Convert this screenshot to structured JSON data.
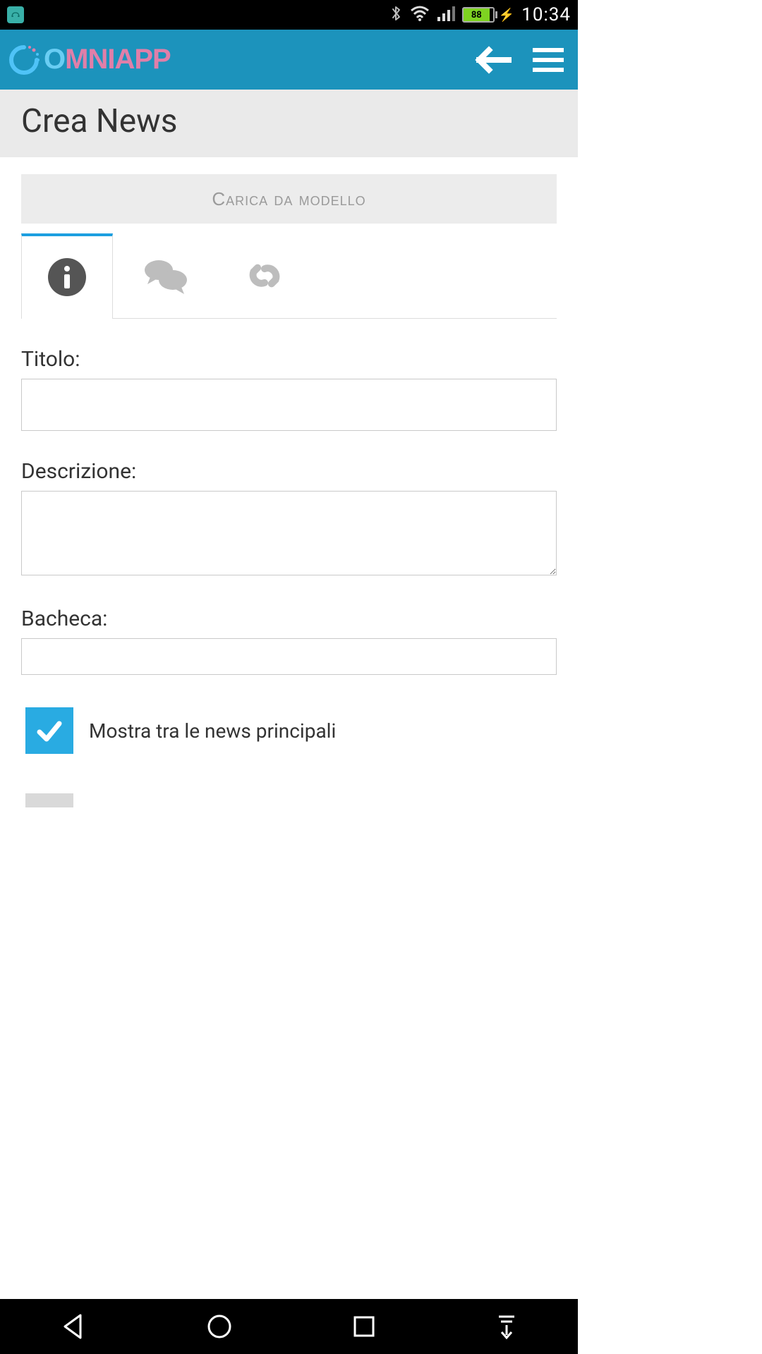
{
  "status_bar": {
    "time": "10:34",
    "battery_pct": "88",
    "icons": [
      "bluetooth",
      "wifi",
      "signal",
      "battery-charging"
    ]
  },
  "header": {
    "app_name": "OmniApp"
  },
  "page": {
    "title": "Crea News",
    "load_template_label": "Carica da modello",
    "tabs": [
      {
        "icon": "info",
        "active": true
      },
      {
        "icon": "comments",
        "active": false
      },
      {
        "icon": "link",
        "active": false
      }
    ],
    "form": {
      "title_label": "Titolo:",
      "title_value": "",
      "description_label": "Descrizione:",
      "description_value": "",
      "board_label": "Bacheca:",
      "board_value": "",
      "show_main_label": "Mostra tra le news principali",
      "show_main_checked": true
    }
  }
}
